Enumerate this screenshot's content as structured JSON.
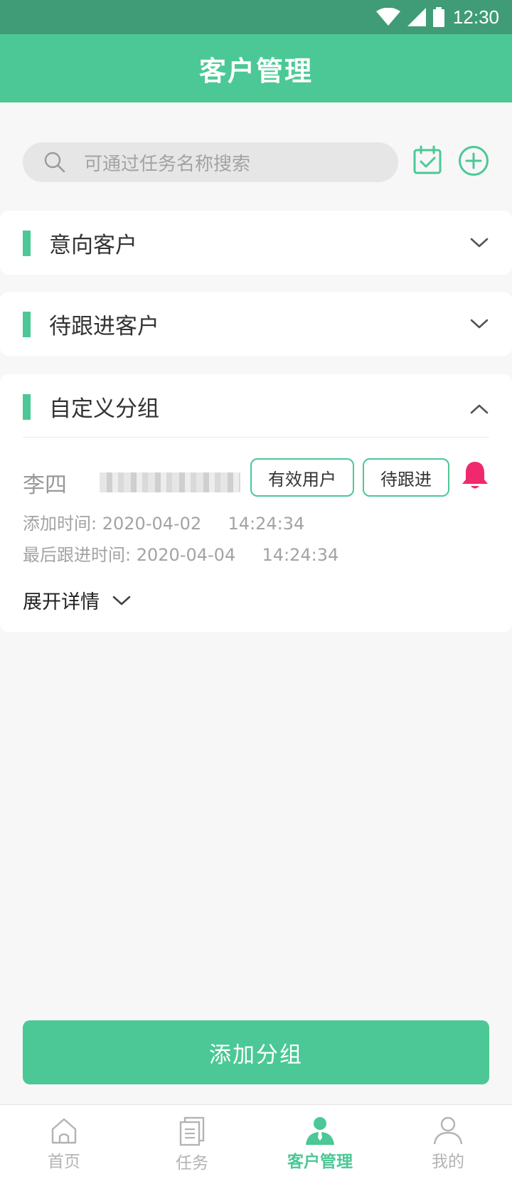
{
  "status_bar": {
    "time": "12:30"
  },
  "app_bar": {
    "title": "客户管理"
  },
  "search": {
    "placeholder": "可通过任务名称搜索"
  },
  "groups": [
    {
      "label": "意向客户",
      "expanded": false
    },
    {
      "label": "待跟进客户",
      "expanded": false
    },
    {
      "label": "自定义分组",
      "expanded": true
    }
  ],
  "customer": {
    "name": "李四",
    "tags": [
      "有效用户",
      "待跟进"
    ],
    "add_time_label": "添加时间:",
    "add_time_date": "2020-04-02",
    "add_time_clock": "14:24:34",
    "last_follow_label": "最后跟进时间:",
    "last_follow_date": "2020-04-04",
    "last_follow_clock": "14:24:34",
    "expand_label": "展开详情"
  },
  "add_group_label": "添加分组",
  "tabs": [
    {
      "label": "首页",
      "icon": "home-icon",
      "active": false
    },
    {
      "label": "任务",
      "icon": "document-icon",
      "active": false
    },
    {
      "label": "客户管理",
      "icon": "customer-icon",
      "active": true
    },
    {
      "label": "我的",
      "icon": "person-icon",
      "active": false
    }
  ],
  "colors": {
    "primary": "#4bc895",
    "status_bar": "#3f9c77",
    "bell": "#f0286e",
    "background": "#f7f7f7"
  }
}
